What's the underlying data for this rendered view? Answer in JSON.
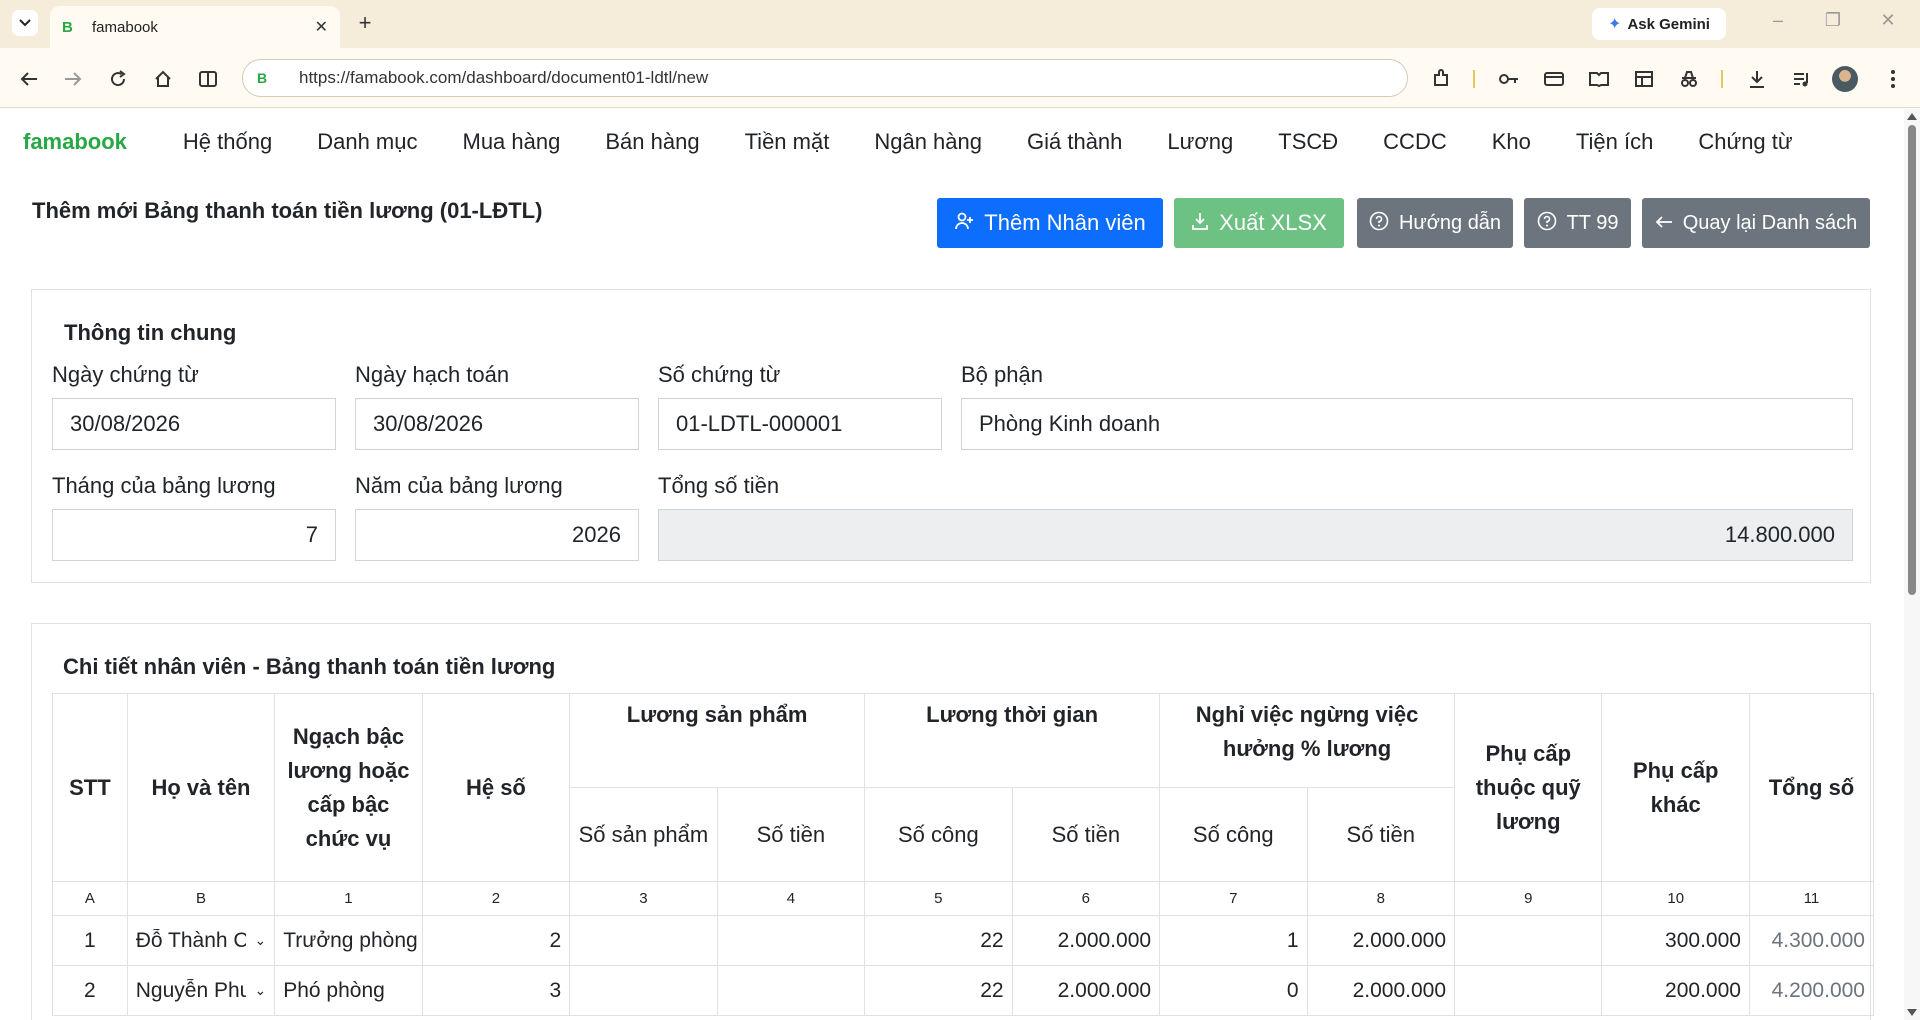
{
  "browser": {
    "tab_title": "famabook",
    "tab_favicon": "B",
    "gemini_label": "Ask Gemini",
    "url": "https://famabook.com/dashboard/document01-ldtl/new",
    "site_badge": "B"
  },
  "nav": {
    "brand": "famabook",
    "items": [
      "Hệ thống",
      "Danh mục",
      "Mua hàng",
      "Bán hàng",
      "Tiền mặt",
      "Ngân hàng",
      "Giá thành",
      "Lương",
      "TSCĐ",
      "CCDC",
      "Kho",
      "Tiện ích",
      "Chứng từ"
    ]
  },
  "header": {
    "title": "Thêm mới Bảng thanh toán tiền lương (01-LĐTL)",
    "buttons": {
      "add_employee": "Thêm Nhân viên",
      "export_xlsx": "Xuất XLSX",
      "guide": "Hướng dẫn",
      "tt99": "TT 99",
      "back": "Quay lại Danh sách"
    }
  },
  "general": {
    "title": "Thông tin chung",
    "doc_date_label": "Ngày chứng từ",
    "doc_date": "30/08/2026",
    "post_date_label": "Ngày hạch toán",
    "post_date": "30/08/2026",
    "doc_no_label": "Số chứng từ",
    "doc_no": "01-LDTL-000001",
    "dept_label": "Bộ phận",
    "dept": "Phòng Kinh doanh",
    "month_label": "Tháng của bảng lương",
    "month": "7",
    "year_label": "Năm của bảng lương",
    "year": "2026",
    "total_label": "Tổng số tiền",
    "total": "14.800.000"
  },
  "detail": {
    "title": "Chi tiết nhân viên - Bảng thanh toán tiền lương",
    "headers": {
      "stt": "STT",
      "name": "Họ và tên",
      "grade": "Ngạch bậc lương hoặc cấp bậc chức vụ",
      "coef": "Hệ số",
      "product_wage": "Lương sản phẩm",
      "time_wage": "Lương thời gian",
      "leave": "Nghỉ việc ngừng việc hưởng % lương",
      "allow_fund": "Phụ cấp thuộc quỹ lương",
      "allow_other": "Phụ cấp khác",
      "total": "Tổng số",
      "qty": "Số sản phẩm",
      "amount": "Số tiền",
      "days": "Số công"
    },
    "letters": [
      "A",
      "B",
      "1",
      "2",
      "3",
      "4",
      "5",
      "6",
      "7",
      "8",
      "9",
      "10",
      "11"
    ],
    "rows": [
      {
        "stt": "1",
        "name": "Đỗ Thành Công",
        "grade": "Trưởng phòng",
        "coef": "2",
        "qty": "",
        "p_amount": "",
        "t_days": "22",
        "t_amount": "2.000.000",
        "l_days": "1",
        "l_amount": "2.000.000",
        "allow_fund": "",
        "allow_other": "300.000",
        "total": "4.300.000"
      },
      {
        "stt": "2",
        "name": "Nguyễn Phương",
        "grade": "Phó phòng",
        "coef": "3",
        "qty": "",
        "p_amount": "",
        "t_days": "22",
        "t_amount": "2.000.000",
        "l_days": "0",
        "l_amount": "2.000.000",
        "allow_fund": "",
        "allow_other": "200.000",
        "total": "4.200.000"
      }
    ]
  }
}
